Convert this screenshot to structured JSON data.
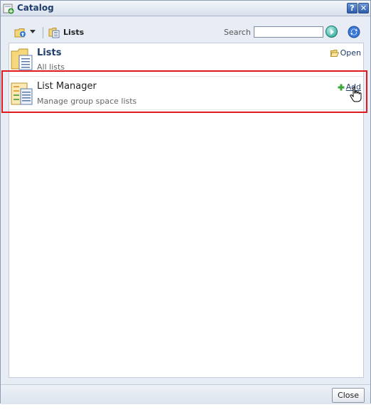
{
  "window": {
    "title": "Catalog"
  },
  "toolbar": {
    "breadcrumb": "Lists",
    "search_label": "Search",
    "search_value": ""
  },
  "items": [
    {
      "title": "Lists",
      "description": "All lists",
      "action": "Open",
      "icon": "folder-icon"
    },
    {
      "title": "List Manager",
      "description": "Manage group space lists",
      "action": "Add",
      "icon": "list-manager-icon"
    }
  ],
  "footer": {
    "close_label": "Close"
  }
}
